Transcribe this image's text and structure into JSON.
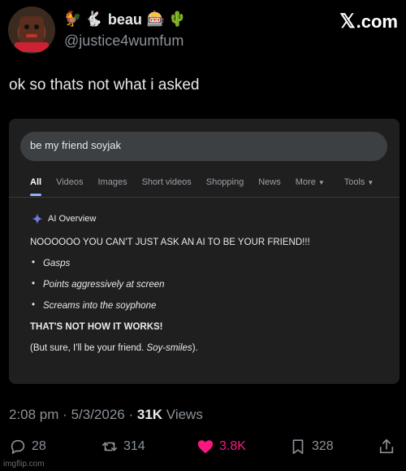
{
  "author": {
    "display_name": "beau",
    "handle": "@justice4wumfum",
    "emojis_before": [
      "🐓",
      "🐇"
    ],
    "emojis_after": [
      "🎰",
      "🌵"
    ]
  },
  "brand": {
    "x_mark": "𝕏",
    "label": ".com"
  },
  "tweet": {
    "text": "ok so thats not what i asked"
  },
  "embed": {
    "search_query": "be my friend soyjak",
    "tabs": [
      "All",
      "Videos",
      "Images",
      "Short videos",
      "Shopping",
      "News",
      "More",
      "Tools"
    ],
    "active_tab": "All",
    "ai_overview": {
      "title": "AI Overview",
      "headline": "NOOOOOO YOU CAN'T JUST ASK AN AI TO BE YOUR FRIEND!!!",
      "bullets": [
        "Gasps",
        "Points aggressively at screen",
        "Screams into the soyphone"
      ],
      "emphasis": "THAT'S NOT HOW IT WORKS!",
      "closing_prefix": "(But sure, I'll be your friend. ",
      "closing_italic": "Soy-smiles",
      "closing_suffix": ")."
    }
  },
  "meta": {
    "time": "2:08 pm",
    "date": "5/3/2026",
    "views_count": "31K",
    "views_label": "Views"
  },
  "actions": {
    "replies": "28",
    "reposts": "314",
    "likes": "3.8K",
    "bookmarks": "328"
  },
  "colors": {
    "like": "#f91880",
    "accent": "#8ab4f8",
    "background": "#000000"
  },
  "watermark": "imgflip.com"
}
